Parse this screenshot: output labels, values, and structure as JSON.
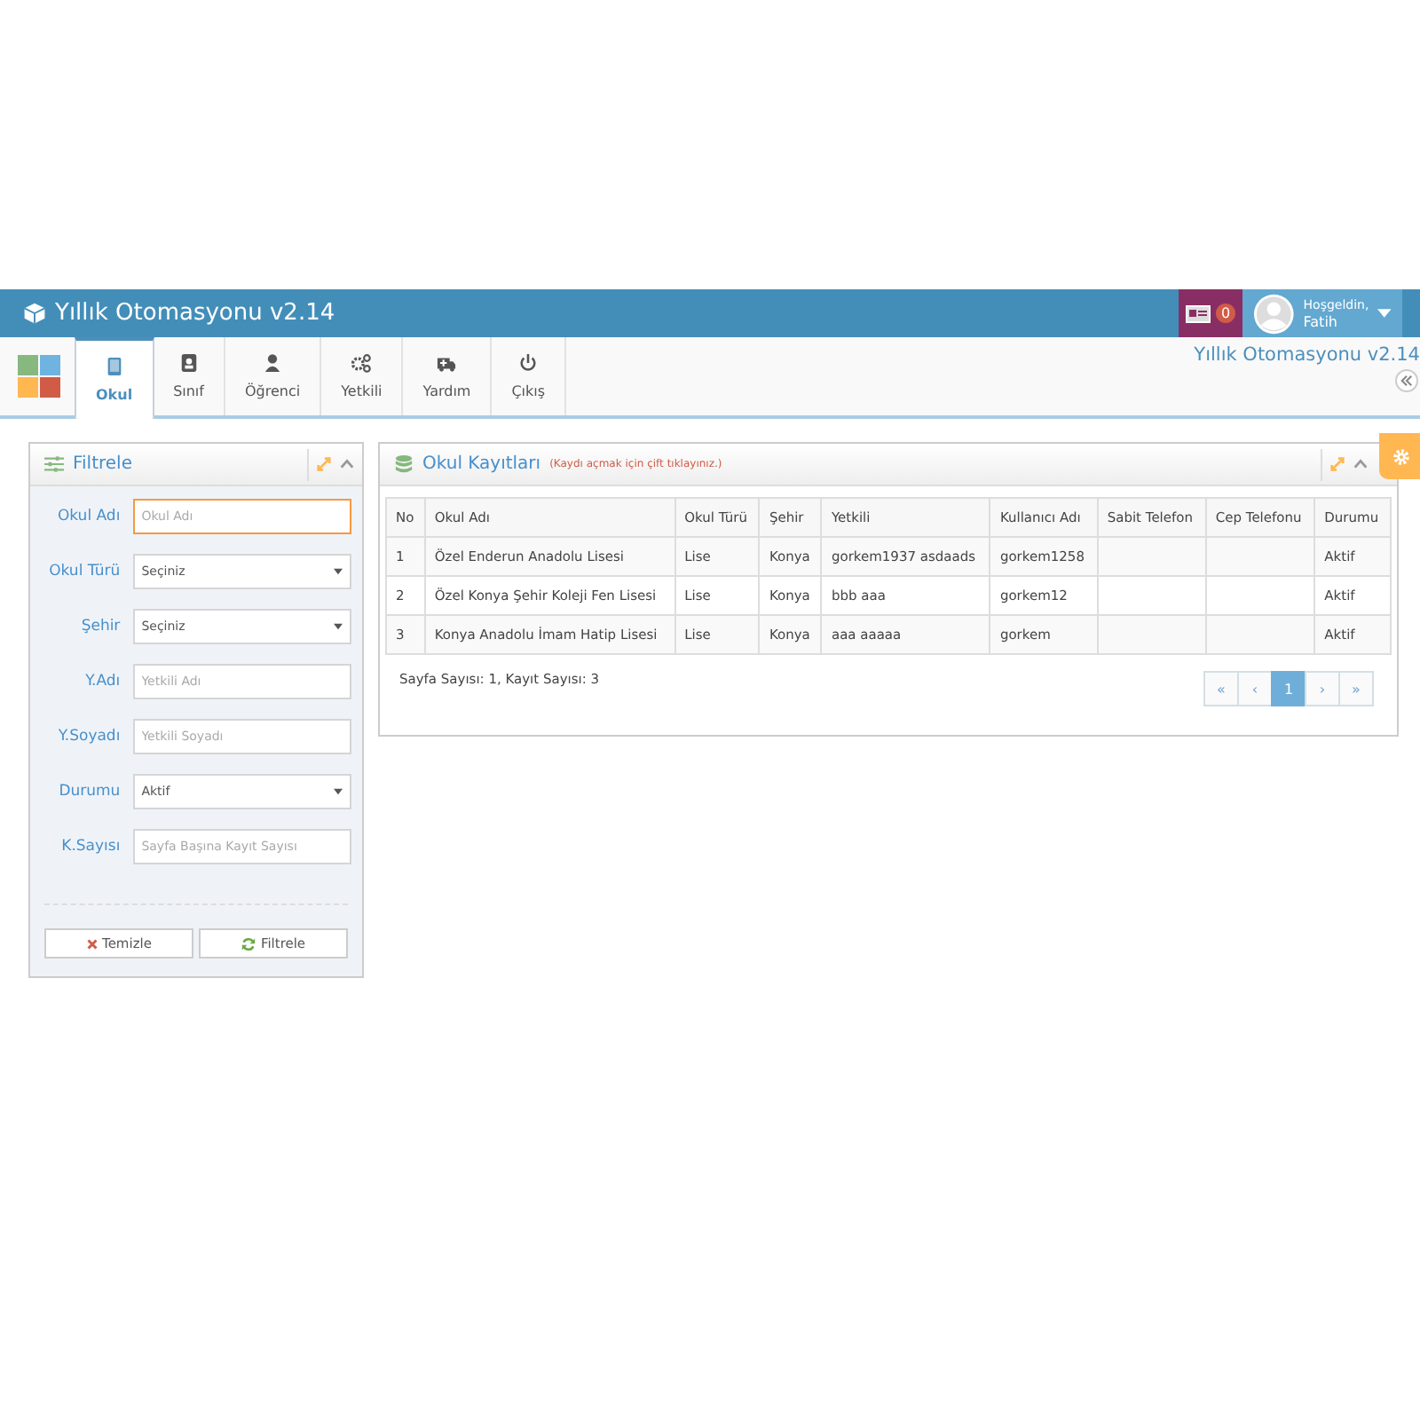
{
  "header": {
    "title": "Yıllık Otomasyonu v2.14",
    "notification_count": "0",
    "greeting": "Hoşgeldin,",
    "user": "Fatih"
  },
  "tabs": [
    {
      "label": "Okul",
      "selected": true
    },
    {
      "label": "Sınıf",
      "selected": false
    },
    {
      "label": "Öğrenci",
      "selected": false
    },
    {
      "label": "Yetkili",
      "selected": false
    },
    {
      "label": "Yardım",
      "selected": false
    },
    {
      "label": "Çıkış",
      "selected": false
    }
  ],
  "breadcrumb_title": "Yıllık Otomasyonu v2.14",
  "filter_panel": {
    "title": "Filtrele",
    "fields": [
      {
        "label": "Okul Adı",
        "kind": "input",
        "placeholder": "Okul Adı",
        "focused": true
      },
      {
        "label": "Okul Türü",
        "kind": "select",
        "value": "Seçiniz",
        "focused": false
      },
      {
        "label": "Şehir",
        "kind": "select",
        "value": "Seçiniz",
        "focused": false
      },
      {
        "label": "Y.Adı",
        "kind": "input",
        "placeholder": "Yetkili Adı",
        "focused": false
      },
      {
        "label": "Y.Soyadı",
        "kind": "input",
        "placeholder": "Yetkili Soyadı",
        "focused": false
      },
      {
        "label": "Durumu",
        "kind": "select",
        "value": "Aktif",
        "focused": false
      },
      {
        "label": "K.Sayısı",
        "kind": "input",
        "placeholder": "Sayfa Başına Kayıt Sayısı",
        "focused": false
      }
    ],
    "clear_button": "Temizle",
    "filter_button": "Filtrele"
  },
  "records_panel": {
    "title": "Okul Kayıtları",
    "hint": "(Kaydı açmak için çift tıklayınız.)",
    "columns": [
      "No",
      "Okul Adı",
      "Okul Türü",
      "Şehir",
      "Yetkili",
      "Kullanıcı Adı",
      "Sabit Telefon",
      "Cep Telefonu",
      "Durumu"
    ],
    "rows": [
      [
        "1",
        "Özel Enderun Anadolu Lisesi",
        "Lise",
        "Konya",
        "gorkem1937 asdaads",
        "gorkem1258",
        "",
        "",
        "Aktif"
      ],
      [
        "2",
        "Özel Konya Şehir Koleji Fen Lisesi",
        "Lise",
        "Konya",
        "bbb aaa",
        "gorkem12",
        "",
        "",
        "Aktif"
      ],
      [
        "3",
        "Konya Anadolu İmam Hatip Lisesi",
        "Lise",
        "Konya",
        "aaa aaaaa",
        "gorkem",
        "",
        "",
        "Aktif"
      ]
    ],
    "summary": "Sayfa Sayısı: 1, Kayıt Sayısı: 3",
    "pagination": [
      {
        "label": "«",
        "selected": false
      },
      {
        "label": "‹",
        "selected": false
      },
      {
        "label": "1",
        "selected": true
      },
      {
        "label": "›",
        "selected": false
      },
      {
        "label": "»",
        "selected": false
      }
    ]
  }
}
